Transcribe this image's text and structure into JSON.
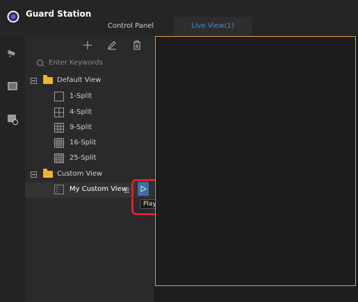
{
  "app": {
    "title": "Guard Station"
  },
  "tabs": [
    {
      "label": "Control Panel",
      "active": false
    },
    {
      "label": "Live View(1)",
      "active": true
    }
  ],
  "rail": {
    "icons": [
      "camera-icon",
      "layout-icon",
      "playback-icon"
    ]
  },
  "toolbar": {
    "add_icon": "plus-icon",
    "edit_icon": "pencil-icon",
    "delete_icon": "trash-icon"
  },
  "search": {
    "placeholder": "Enter Keywords"
  },
  "tree": {
    "default_view": {
      "label": "Default View",
      "items": [
        {
          "label": "1-Split",
          "icon": "split-1-icon"
        },
        {
          "label": "4-Split",
          "icon": "split-4-icon"
        },
        {
          "label": "9-Split",
          "icon": "split-9-icon"
        },
        {
          "label": "16-Split",
          "icon": "split-16-icon"
        },
        {
          "label": "25-Split",
          "icon": "split-25-icon"
        }
      ]
    },
    "custom_view": {
      "label": "Custom View",
      "items": [
        {
          "label": "My Custom View",
          "icon": "custom-view-icon",
          "selected": true
        }
      ]
    }
  },
  "tooltip": {
    "text": "Play"
  },
  "colors": {
    "accent": "#3f8ce6",
    "frame": "#e4a43a",
    "highlight": "#e0202c",
    "folder": "#f0b52b"
  }
}
